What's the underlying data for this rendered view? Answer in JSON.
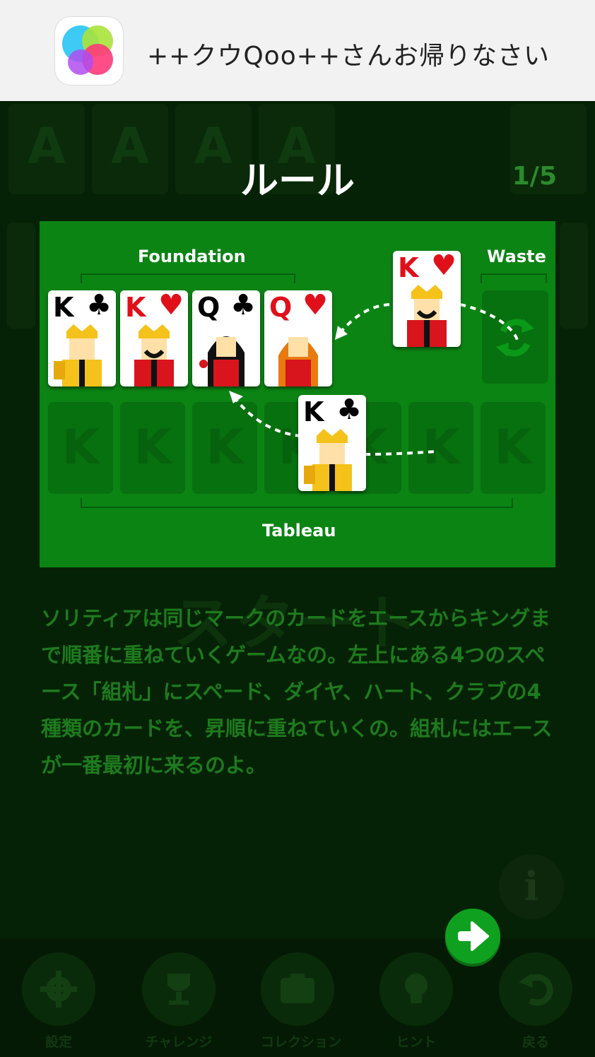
{
  "notification": {
    "message": "++クウQoo++さんお帰りなさい",
    "icon": "game-center-icon"
  },
  "background": {
    "foundation_ghost_labels": [
      "A",
      "A",
      "A",
      "A"
    ],
    "start_label": "スタート"
  },
  "dialog": {
    "title": "ルール",
    "page_indicator": "1/5",
    "description": "ソリティアは同じマークのカードをエースからキングまで順番に重ねていくゲームなの。左上にある4つのスペース「組札」にスペード、ダイヤ、ハート、クラブの4種類のカードを、昇順に重ねていくの。組札にはエースが一番最初に来るのよ。",
    "next_button_icon": "arrow-right-icon"
  },
  "illustration": {
    "foundation_label": "Foundation",
    "waste_label": "Waste",
    "tableau_label": "Tableau",
    "tableau_slot_label": "K",
    "foundation_cards": [
      {
        "rank": "K",
        "suit": "♣",
        "color": "#000000"
      },
      {
        "rank": "K",
        "suit": "♥",
        "color": "#e0101a"
      },
      {
        "rank": "Q",
        "suit": "♣",
        "color": "#000000"
      },
      {
        "rank": "Q",
        "suit": "♥",
        "color": "#e0101a"
      }
    ],
    "waste_card": {
      "rank": "K",
      "suit": "♥",
      "color": "#e0101a"
    },
    "tableau_card": {
      "rank": "K",
      "suit": "♣",
      "color": "#000000"
    }
  },
  "bottom_nav": [
    {
      "label": "設定",
      "icon": "gear-icon"
    },
    {
      "label": "チャレンジ",
      "icon": "trophy-icon"
    },
    {
      "label": "コレクション",
      "icon": "collection-icon"
    },
    {
      "label": "ヒント",
      "icon": "lightbulb-icon"
    },
    {
      "label": "戻る",
      "icon": "undo-icon"
    }
  ],
  "colors": {
    "felt": "#0b8414",
    "accent": "#0fa020",
    "text_green": "#1e7a1e",
    "background": "#062206"
  }
}
